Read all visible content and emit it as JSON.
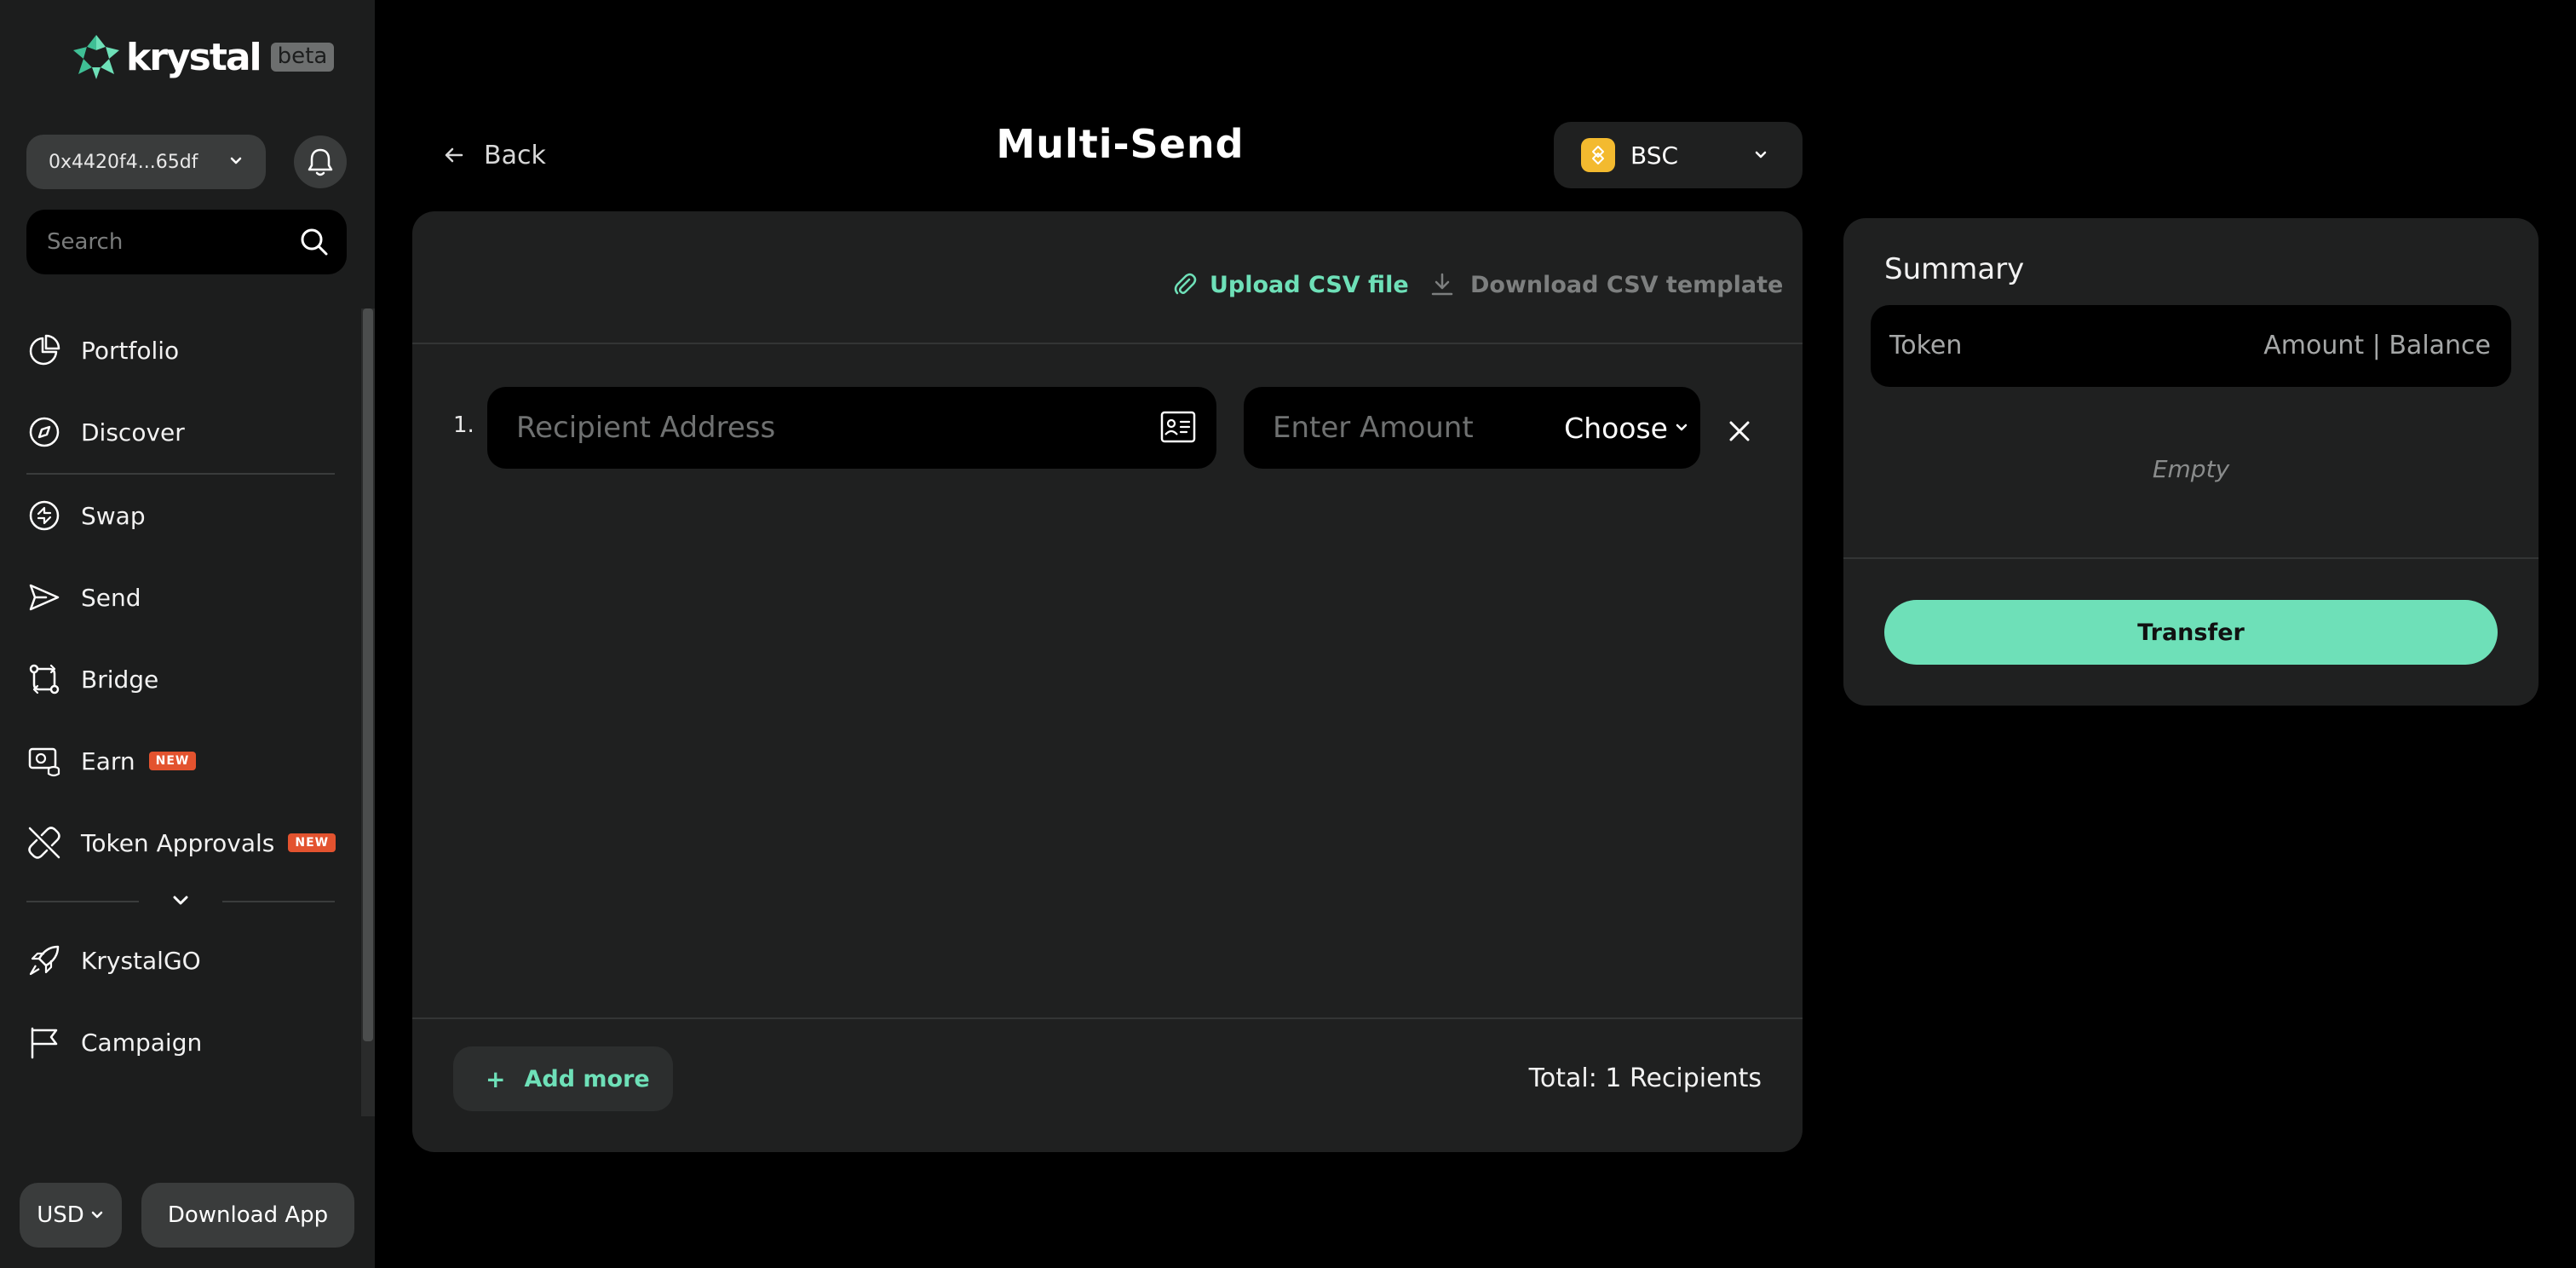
{
  "brand": {
    "name": "krystal",
    "badge": "beta",
    "accent": "#6ee0b8"
  },
  "wallet": {
    "address": "0x4420f4...65df"
  },
  "search": {
    "placeholder": "Search"
  },
  "sidebar": {
    "items": [
      {
        "label": "Portfolio",
        "icon": "pie-chart-icon"
      },
      {
        "label": "Discover",
        "icon": "compass-icon"
      },
      {
        "label": "Swap",
        "icon": "swap-icon"
      },
      {
        "label": "Send",
        "icon": "send-icon"
      },
      {
        "label": "Bridge",
        "icon": "bridge-icon"
      },
      {
        "label": "Earn",
        "icon": "earn-icon",
        "badge": "NEW"
      },
      {
        "label": "Token Approvals",
        "icon": "unlink-icon",
        "badge": "NEW"
      },
      {
        "label": "KrystalGO",
        "icon": "rocket-icon"
      },
      {
        "label": "Campaign",
        "icon": "flag-icon"
      }
    ]
  },
  "footer": {
    "currency": "USD",
    "download_label": "Download App"
  },
  "header": {
    "back_label": "Back",
    "title": "Multi-Send",
    "chain": "BSC"
  },
  "form": {
    "upload_label": "Upload CSV file",
    "template_label": "Download CSV template",
    "rows": [
      {
        "index": "1.",
        "address_placeholder": "Recipient Address",
        "amount_placeholder": "Enter Amount",
        "token_label": "Choose"
      }
    ],
    "add_more_label": "Add more",
    "total_label": "Total: 1 Recipients"
  },
  "summary": {
    "title": "Summary",
    "col_token": "Token",
    "col_amount": "Amount | Balance",
    "empty_label": "Empty",
    "transfer_label": "Transfer"
  }
}
